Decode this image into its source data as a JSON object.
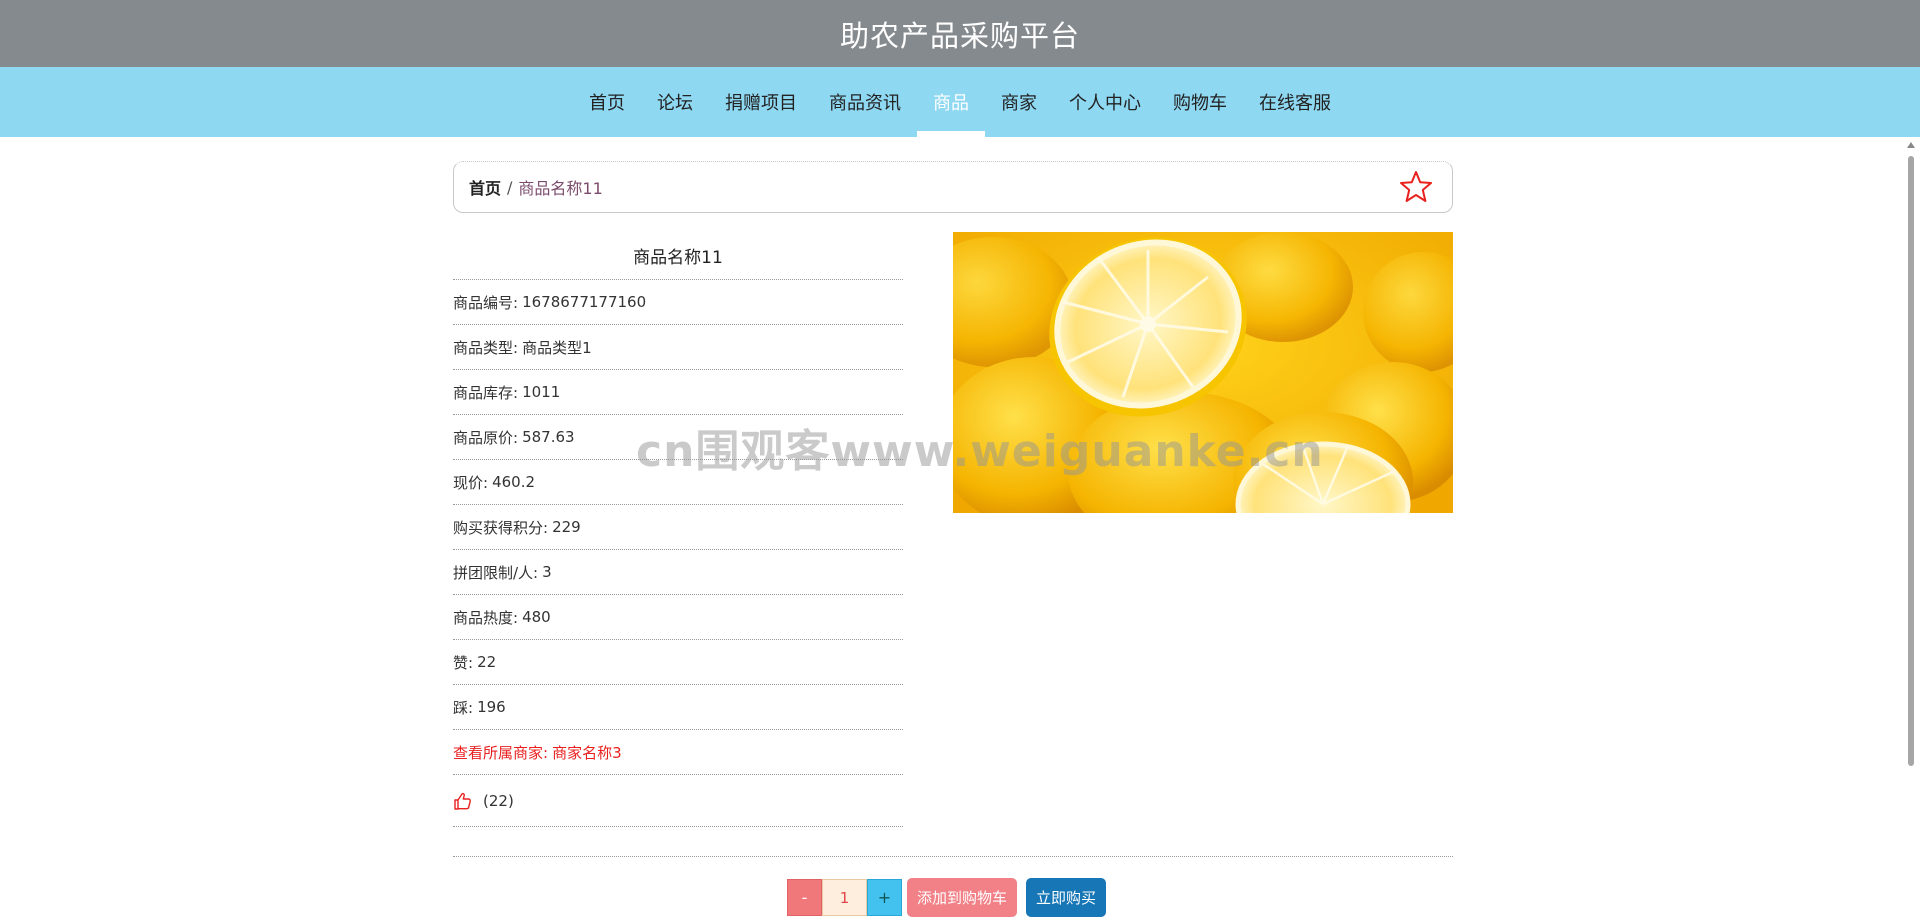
{
  "header": {
    "title": "助农产品采购平台"
  },
  "nav": {
    "items": [
      {
        "label": "首页"
      },
      {
        "label": "论坛"
      },
      {
        "label": "捐赠项目"
      },
      {
        "label": "商品资讯"
      },
      {
        "label": "商品",
        "active": true
      },
      {
        "label": "商家"
      },
      {
        "label": "个人中心"
      },
      {
        "label": "购物车"
      },
      {
        "label": "在线客服"
      }
    ]
  },
  "breadcrumb": {
    "home": "首页",
    "separator": "/",
    "current": "商品名称11"
  },
  "icons": {
    "favorite": "star-outline-icon",
    "like": "thumbs-up-icon"
  },
  "colors": {
    "accent_red": "#e8211f",
    "nav_bg": "#8fd8f2",
    "title_bg": "#848a8e",
    "buy_button": "#1676b6",
    "cart_button": "#f18087"
  },
  "product": {
    "name": "商品名称11",
    "rows": [
      {
        "label": "商品编号:",
        "value": "1678677177160"
      },
      {
        "label": "商品类型:",
        "value": "商品类型1"
      },
      {
        "label": "商品库存:",
        "value": "1011"
      },
      {
        "label": "商品原价:",
        "value": "587.63"
      },
      {
        "label": "现价:",
        "value": "460.2"
      },
      {
        "label": "购买获得积分:",
        "value": "229"
      },
      {
        "label": "拼团限制/人:",
        "value": "3"
      },
      {
        "label": "商品热度:",
        "value": "480"
      },
      {
        "label": "赞:",
        "value": "22"
      },
      {
        "label": "踩:",
        "value": "196"
      }
    ],
    "merchant": {
      "label": "查看所属商家:",
      "value": "商家名称3"
    },
    "like_count": "(22)"
  },
  "actions": {
    "minus": "-",
    "quantity": "1",
    "plus": "+",
    "add_to_cart": "添加到购物车",
    "buy_now": "立即购买"
  },
  "watermark": "cn围观客www.weiguanke.cn"
}
